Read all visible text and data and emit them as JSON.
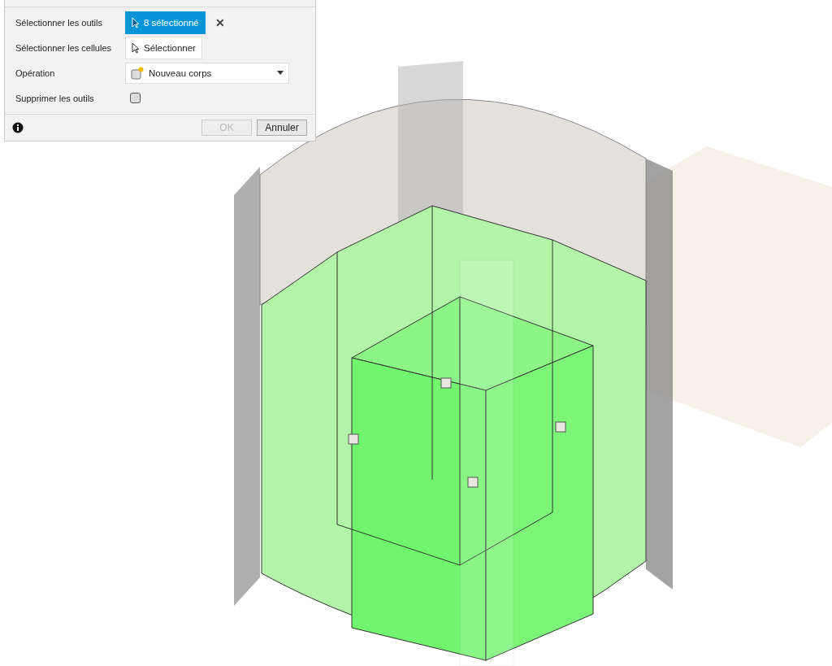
{
  "dialog": {
    "rows": [
      {
        "kind": "selection",
        "label": "Sélectionner les outils",
        "button": "8 sélectionné",
        "selected": true,
        "clear": "✕"
      },
      {
        "kind": "selection",
        "label": "Sélectionner les cellules",
        "button": "Sélectionner",
        "selected": false
      },
      {
        "kind": "dropdown",
        "label": "Opération",
        "value": "Nouveau corps"
      },
      {
        "kind": "checkbox",
        "label": "Supprimer les outils",
        "checked": false
      }
    ],
    "footer": {
      "ok": {
        "label": "OK",
        "disabled": true
      },
      "cancel": {
        "label": "Annuler",
        "disabled": false
      }
    }
  }
}
